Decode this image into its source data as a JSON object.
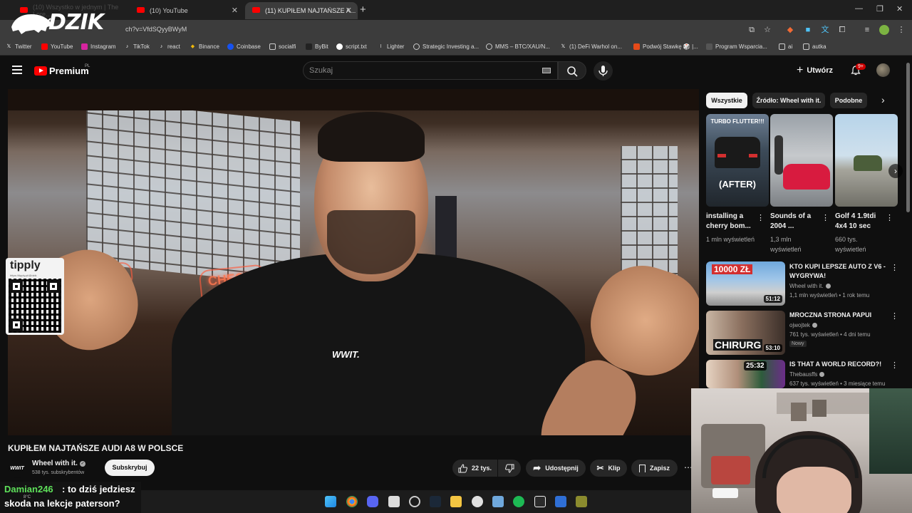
{
  "browser": {
    "tabs": [
      {
        "label": "(10) Wszystko w jednym | The Lore..."
      },
      {
        "label": "(10) YouTube"
      },
      {
        "label": "(11) KUPIŁEM NAJTAŃSZE A..."
      }
    ],
    "url": "ch?v=VfdSQyyBWyM",
    "bookmarks": [
      "Twitter",
      "YouTube",
      "Instagram",
      "TikTok",
      "react",
      "Binance",
      "Coinbase",
      "socialfi",
      "ByBit",
      "script.txt",
      "Lighter",
      "Strategic Investing a...",
      "MMS – BTC/XAU/N...",
      "(1) DeFi Warhol on...",
      "Podwój Stawkę 🎲 |...",
      "Program Wsparcia...",
      "ai",
      "autka"
    ]
  },
  "overlay": {
    "logo_text": "DZIK",
    "tipply_title": "tipply",
    "tipply_url": "https://tipply.pl/@dzik"
  },
  "header": {
    "brand": "Premium",
    "brand_region": "PL",
    "search_placeholder": "Szukaj",
    "create_label": "Utwórz",
    "notif_count": "9+"
  },
  "video": {
    "title": "KUPIŁEM NAJTAŃSZE AUDI A8 W POLSCE",
    "shirt_text": "WWIT.",
    "channel": {
      "name": "Wheel with it.",
      "avatar_text": "WWIT",
      "subs": "538 tys. subskrybentów",
      "subscribe_label": "Subskrybuj"
    },
    "actions": {
      "likes": "22 tys.",
      "share": "Udostępnij",
      "clip": "Klip",
      "save": "Zapisz"
    }
  },
  "sidebar": {
    "chips": [
      "Wszystkie",
      "Źródło: Wheel with it.",
      "Podobne"
    ],
    "shorts": [
      {
        "title": "installing a cherry bom...",
        "views": "1 mln wyświetleń",
        "overlay_top": "TURBO FLUTTER!!!",
        "overlay_bottom": "(AFTER)"
      },
      {
        "title": "Sounds of a 2004 ...",
        "views": "1,3 mln wyświetleń"
      },
      {
        "title": "Golf 4 1.9tdi 4x4 10 sec",
        "views": "660 tys. wyświetleń"
      }
    ],
    "recommended": [
      {
        "title": "KTO KUPI LEPSZE AUTO Z V6 - WYGRYWA!",
        "channel": "Wheel with it.",
        "meta": "1,1 mln wyświetleń • 1 rok temu",
        "duration": "51:12",
        "thumb_text": "10000 ZŁ"
      },
      {
        "title": "MROCZNA STRONA PAPUI",
        "channel": "ojwojtek",
        "meta": "761 tys. wyświetleń • 4 dni temu",
        "duration": "53:10",
        "badge": "Nowy",
        "thumb_text": "CHIRURG"
      },
      {
        "title": "IS THAT A WORLD RECORD?!",
        "channel": "Thebausffs",
        "meta": "637 tys. wyświetleń • 3 miesiące temu",
        "duration": "25:32"
      }
    ]
  },
  "chat": {
    "user": "Damian246",
    "message_line1": ": to dziś jedziesz",
    "message_line2": "skoda na lekcje paterson?"
  },
  "taskbar": {
    "temp": "8°C"
  },
  "colors": {
    "accent": "#ff0000",
    "chat_user": "#5ee05a",
    "background": "#0f0f0f"
  }
}
